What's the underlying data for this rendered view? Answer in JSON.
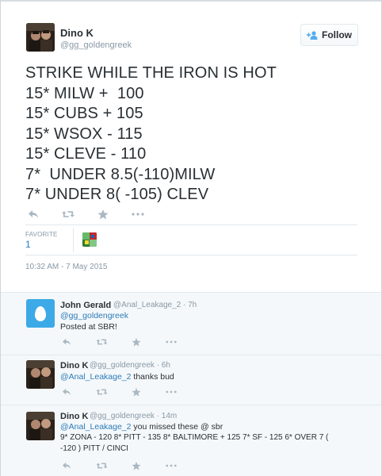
{
  "tweet": {
    "name": "Dino K",
    "handle": "@gg_goldengreek",
    "follow_label": "Follow",
    "lines": [
      "STRIKE WHILE THE IRON IS HOT",
      "15* MILW +  100",
      "15* CUBS + 105",
      "15* WSOX - 115",
      "15* CLEVE - 110",
      "7*  UNDER 8.5(-110)MILW",
      "7* UNDER 8( -105) CLEV"
    ],
    "favorite_label": "FAVORITE",
    "favorite_count": "1",
    "timestamp": "10:32 AM - 7 May 2015"
  },
  "replies": [
    {
      "name": "John Gerald",
      "handle": "@Anal_Leakage_2",
      "age": "· 7h",
      "mention": "@gg_goldengreek",
      "text": "Posted at SBR!"
    },
    {
      "name": "Dino K",
      "handle": "@gg_goldengreek",
      "age": "· 6h",
      "mention": "@Anal_Leakage_2",
      "text": " thanks bud"
    },
    {
      "name": "Dino K",
      "handle": "@gg_goldengreek",
      "age": "· 14m",
      "mention": "@Anal_Leakage_2",
      "text": " you missed these @ sbr",
      "text2": "9* ZONA - 120 8* PITT - 135 8* BALTIMORE + 125 7* SF - 125  6* OVER 7 (",
      "text3": "-120 ) PITT / CINCI"
    }
  ],
  "icons": {
    "reply": "reply-icon",
    "retweet": "retweet-icon",
    "favorite": "star-icon",
    "more": "more-icon",
    "follow": "add-user-icon"
  },
  "colors": {
    "link": "#2b7bb9",
    "muted": "#8899a6",
    "text": "#292f33",
    "icon": "#aab8c2",
    "egg": "#3daae7"
  }
}
